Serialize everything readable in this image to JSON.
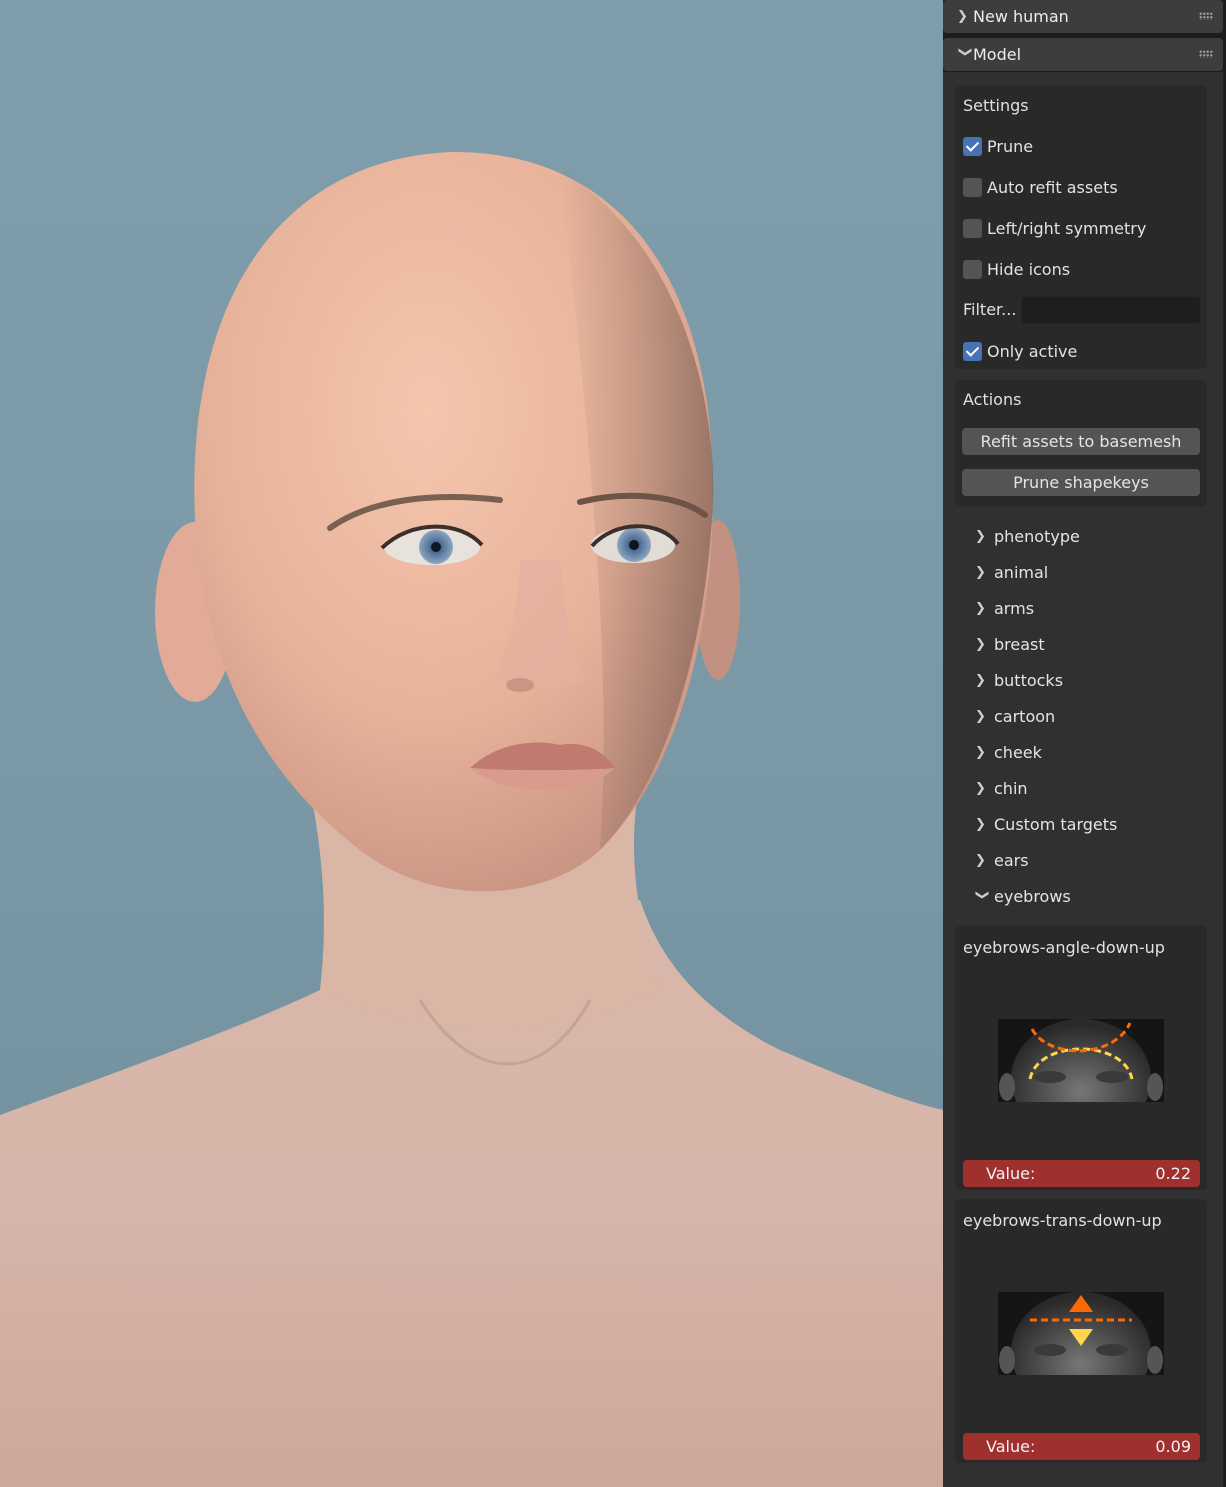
{
  "panel": {
    "new_human": {
      "label": "New human"
    },
    "model": {
      "label": "Model",
      "settings": {
        "title": "Settings",
        "options": [
          {
            "label": "Prune",
            "checked": true
          },
          {
            "label": "Auto refit assets",
            "checked": false
          },
          {
            "label": "Left/right symmetry",
            "checked": false
          },
          {
            "label": "Hide icons",
            "checked": false
          }
        ],
        "filter": {
          "label": "Filter...",
          "value": ""
        },
        "only_active": {
          "label": "Only active",
          "checked": true
        }
      },
      "actions": {
        "title": "Actions",
        "refit_label": "Refit assets to basemesh",
        "prune_label": "Prune shapekeys"
      },
      "categories": [
        {
          "label": "phenotype",
          "expanded": false
        },
        {
          "label": "animal",
          "expanded": false
        },
        {
          "label": "arms",
          "expanded": false
        },
        {
          "label": "breast",
          "expanded": false
        },
        {
          "label": "buttocks",
          "expanded": false
        },
        {
          "label": "cartoon",
          "expanded": false
        },
        {
          "label": "cheek",
          "expanded": false
        },
        {
          "label": "chin",
          "expanded": false
        },
        {
          "label": "Custom targets",
          "expanded": false
        },
        {
          "label": "ears",
          "expanded": false
        },
        {
          "label": "eyebrows",
          "expanded": true
        }
      ],
      "targets": [
        {
          "name": "eyebrows-angle-down-up",
          "value_label": "Value:",
          "value": "0.22",
          "icon": "eyebrow-angle-thumbnail"
        },
        {
          "name": "eyebrows-trans-down-up",
          "value_label": "Value:",
          "value": "0.09",
          "icon": "eyebrow-translate-thumbnail"
        }
      ]
    }
  },
  "colors": {
    "panel_bg": "#303030",
    "box_bg": "#292929",
    "checkbox_on": "#4772b3",
    "slider": "#a0302e",
    "viewport_bg": "#7a98a6"
  }
}
